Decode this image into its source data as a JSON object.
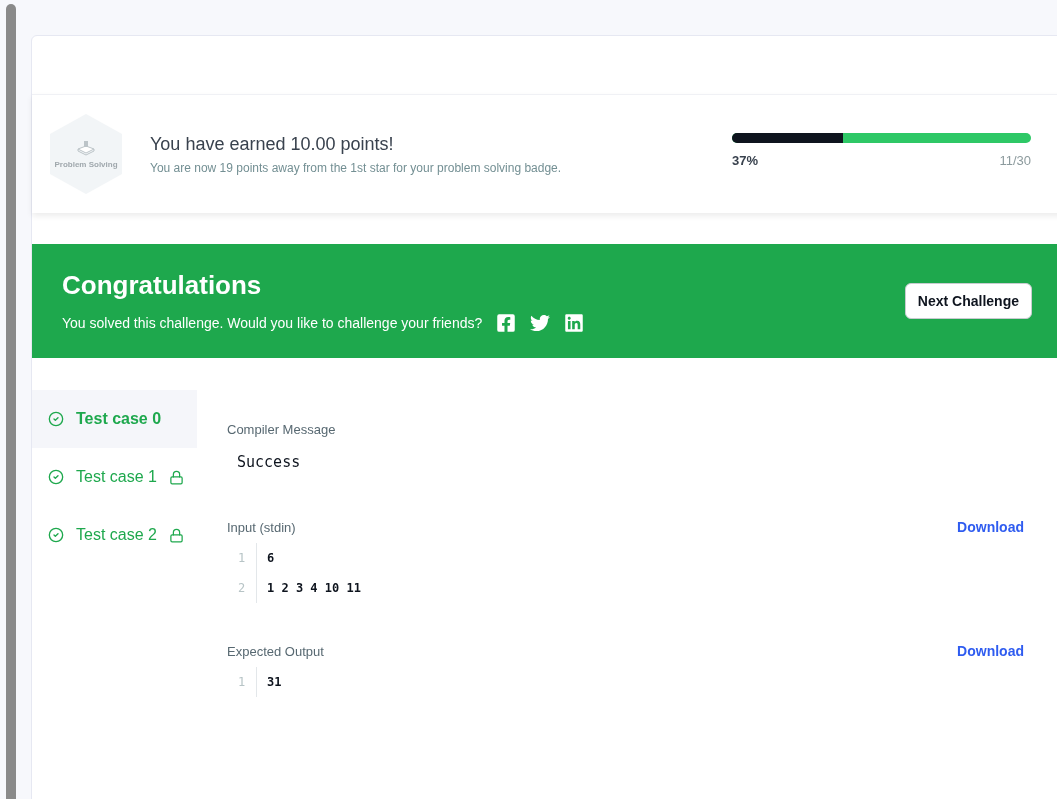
{
  "badge": {
    "label": "Problem Solving"
  },
  "earned": {
    "title": "You have earned 10.00 points!",
    "subtitle": "You are now 19 points away from the 1st star for your problem solving badge.",
    "progress": {
      "level": 0.37,
      "percent": "37%",
      "count": "11/30"
    }
  },
  "banner": {
    "title": "Congratulations",
    "message": "You solved this challenge. Would you like to challenge your friends?",
    "share": [
      {
        "kind": "facebook"
      },
      {
        "kind": "twitter"
      },
      {
        "kind": "linkedin"
      }
    ],
    "button": "Next Challenge"
  },
  "test_cases": [
    {
      "label": "Test case 0",
      "selected": true,
      "passed": true,
      "locked": false
    },
    {
      "label": "Test case 1",
      "selected": false,
      "passed": true,
      "locked": true
    },
    {
      "label": "Test case 2",
      "selected": false,
      "passed": true,
      "locked": true
    }
  ],
  "compiler_message": {
    "label": "Compiler Message",
    "value": "Success"
  },
  "sections": [
    {
      "label": "Input (stdin)",
      "action": "Download",
      "lines": [
        {
          "number": "1",
          "text": "6"
        },
        {
          "number": "2",
          "text": "1 2 3 4 10 11"
        }
      ]
    },
    {
      "label": "Expected Output",
      "action": "Download",
      "lines": [
        {
          "number": "1",
          "text": "31"
        }
      ]
    }
  ]
}
